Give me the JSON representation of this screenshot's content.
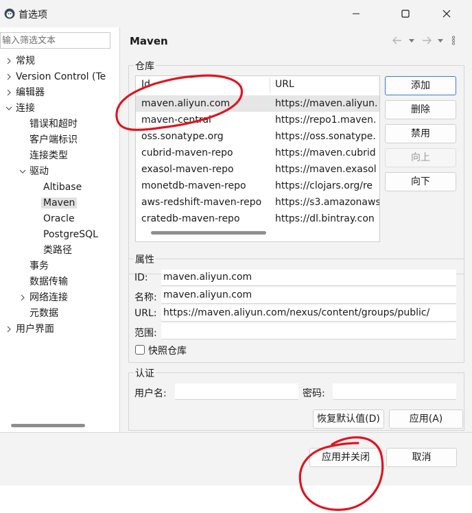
{
  "window": {
    "title": "首选项",
    "controls": [
      "minimize-icon",
      "maximize-icon",
      "close-icon"
    ]
  },
  "filter": {
    "placeholder": "输入筛选文本",
    "value": ""
  },
  "tree": [
    {
      "label": "常规",
      "expanded": false
    },
    {
      "label": "Version Control (Te",
      "expanded": false
    },
    {
      "label": "编辑器",
      "expanded": false
    },
    {
      "label": "连接",
      "expanded": true
    },
    {
      "label": "错误和超时"
    },
    {
      "label": "客户端标识"
    },
    {
      "label": "连接类型"
    },
    {
      "label": "驱动",
      "expanded": true
    },
    {
      "label": "Altibase"
    },
    {
      "label": "Maven",
      "selected": true
    },
    {
      "label": "Oracle"
    },
    {
      "label": "PostgreSQL"
    },
    {
      "label": "类路径"
    },
    {
      "label": "事务"
    },
    {
      "label": "数据传输"
    },
    {
      "label": "网络连接",
      "expanded": false
    },
    {
      "label": "元数据"
    },
    {
      "label": "用户界面",
      "expanded": false
    }
  ],
  "page": {
    "title": "Maven"
  },
  "repos": {
    "group_label": "仓库",
    "columns": [
      "Id",
      "URL"
    ],
    "rows": [
      {
        "id": "maven.aliyun.com",
        "url": "https://maven.aliyun.",
        "selected": true
      },
      {
        "id": "maven-central",
        "url": "https://repo1.maven."
      },
      {
        "id": "oss.sonatype.org",
        "url": "https://oss.sonatype."
      },
      {
        "id": "cubrid-maven-repo",
        "url": "https://maven.cubrid"
      },
      {
        "id": "exasol-maven-repo",
        "url": "https://maven.exasol"
      },
      {
        "id": "monetdb-maven-repo",
        "url": "https://clojars.org/re"
      },
      {
        "id": "aws-redshift-maven-repo",
        "url": "https://s3.amazonaws"
      },
      {
        "id": "cratedb-maven-repo",
        "url": "https://dl.bintray.con"
      }
    ],
    "buttons": {
      "add": "添加",
      "delete": "删除",
      "disable": "禁用",
      "up": "向上",
      "down": "向下"
    }
  },
  "props": {
    "group_label": "属性",
    "id_label": "ID:",
    "id_value": "maven.aliyun.com",
    "name_label": "名称:",
    "name_value": "maven.aliyun.com",
    "url_label": "URL:",
    "url_value": "https://maven.aliyun.com/nexus/content/groups/public/",
    "scope_label": "范围:",
    "scope_value": "",
    "snapshot_label": "快照仓库",
    "snapshot_checked": false
  },
  "auth": {
    "group_label": "认证",
    "user_label": "用户名:",
    "user_value": "",
    "password_label": "密码:",
    "password_value": ""
  },
  "buttons": {
    "restore_defaults": "恢复默认值(D)",
    "apply": "应用(A)",
    "apply_close": "应用并关闭",
    "cancel": "取消"
  },
  "colors": {
    "annotation_red": "#e0141e",
    "selection": "#e1e1e1",
    "focus_border": "#3a7bd5"
  }
}
